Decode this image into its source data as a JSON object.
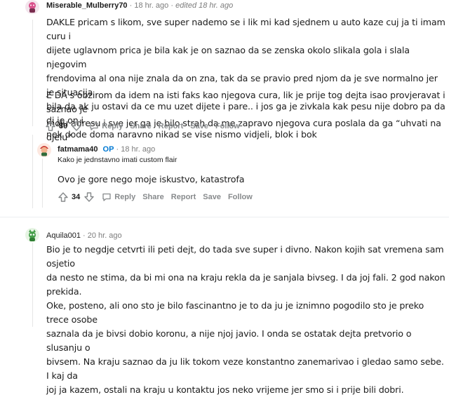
{
  "comments": [
    {
      "username": "Miserable_Mulberry70",
      "time": "18 hr. ago",
      "edited": "edited 18 hr. ago",
      "paragraphs": [
        [
          "DAKLE pricam s likom, sve super nademo se i lik mi kad sjednem u auto kaze cuj ja ti imam curu i",
          "dijete uglavnom prica je bila kak je on saznao da se zenska okolo slikala gola i slala njegovim",
          "frendovima al ona nije znala da on zna, tak da se pravio pred njom da je sve normalno jer je situacija",
          "bila da ak ju ostavi da ce mu uzet dijete i pare.. i jos ga je zivkala kak pesu nije dobro pa da di je on i",
          "nek dode doma naravno nikad se vise nismo vidjeli, blok i bok"
        ],
        [
          "E DA s obzirom da idem na isti faks kao njegova cura, lik je prije tog dejta isao provjeravat i saznao je",
          "moju adresu i sve jer ga je bilo strah da me zapravo njegova cura poslala da ga “uhvati na djelu”"
        ]
      ],
      "score": "80",
      "actions": [
        "Reply",
        "Share",
        "Report",
        "Save",
        "Follow"
      ]
    },
    {
      "username": "fatmama40",
      "op_badge": "OP",
      "time": "18 hr. ago",
      "flair": "Kako je jednstavno imati custom flair",
      "paragraphs": [
        [
          "Ovo je gore nego moje iskustvo, katastrofa"
        ]
      ],
      "score": "34",
      "actions": [
        "Reply",
        "Share",
        "Report",
        "Save",
        "Follow"
      ]
    },
    {
      "username": "Aquila001",
      "time": "20 hr. ago",
      "paragraphs": [
        [
          "Bio je to negdje cetvrti ili peti dejt, do tada sve super i divno. Nakon kojih sat vremena sam osjetio",
          "da nesto ne stima, da bi mi ona na kraju rekla da je sanjala bivseg. I da joj fali. 2 god nakon prekida.",
          "Oke, posteno, ali ono sto je bilo fascinantno je to da ju je iznimno pogodilo sto je preko trece osobe",
          "saznala da je bivsi dobio koronu, a nije njoj javio. I onda se ostatak dejta pretvorio o slusanju o",
          "bivsem. Na kraju saznao da ju lik tokom veze konstantno zanemarivao i gledao samo sebe. I kaj da",
          "joj ja kazem, ostali na kraju u kontaktu jos neko vrijeme jer smo si i prije bili dobri."
        ]
      ]
    }
  ],
  "colors": {
    "accent": "#0079d3",
    "muted": "#878a8c",
    "thread_line": "#e6e6e6",
    "text": "#1c1c1c"
  }
}
